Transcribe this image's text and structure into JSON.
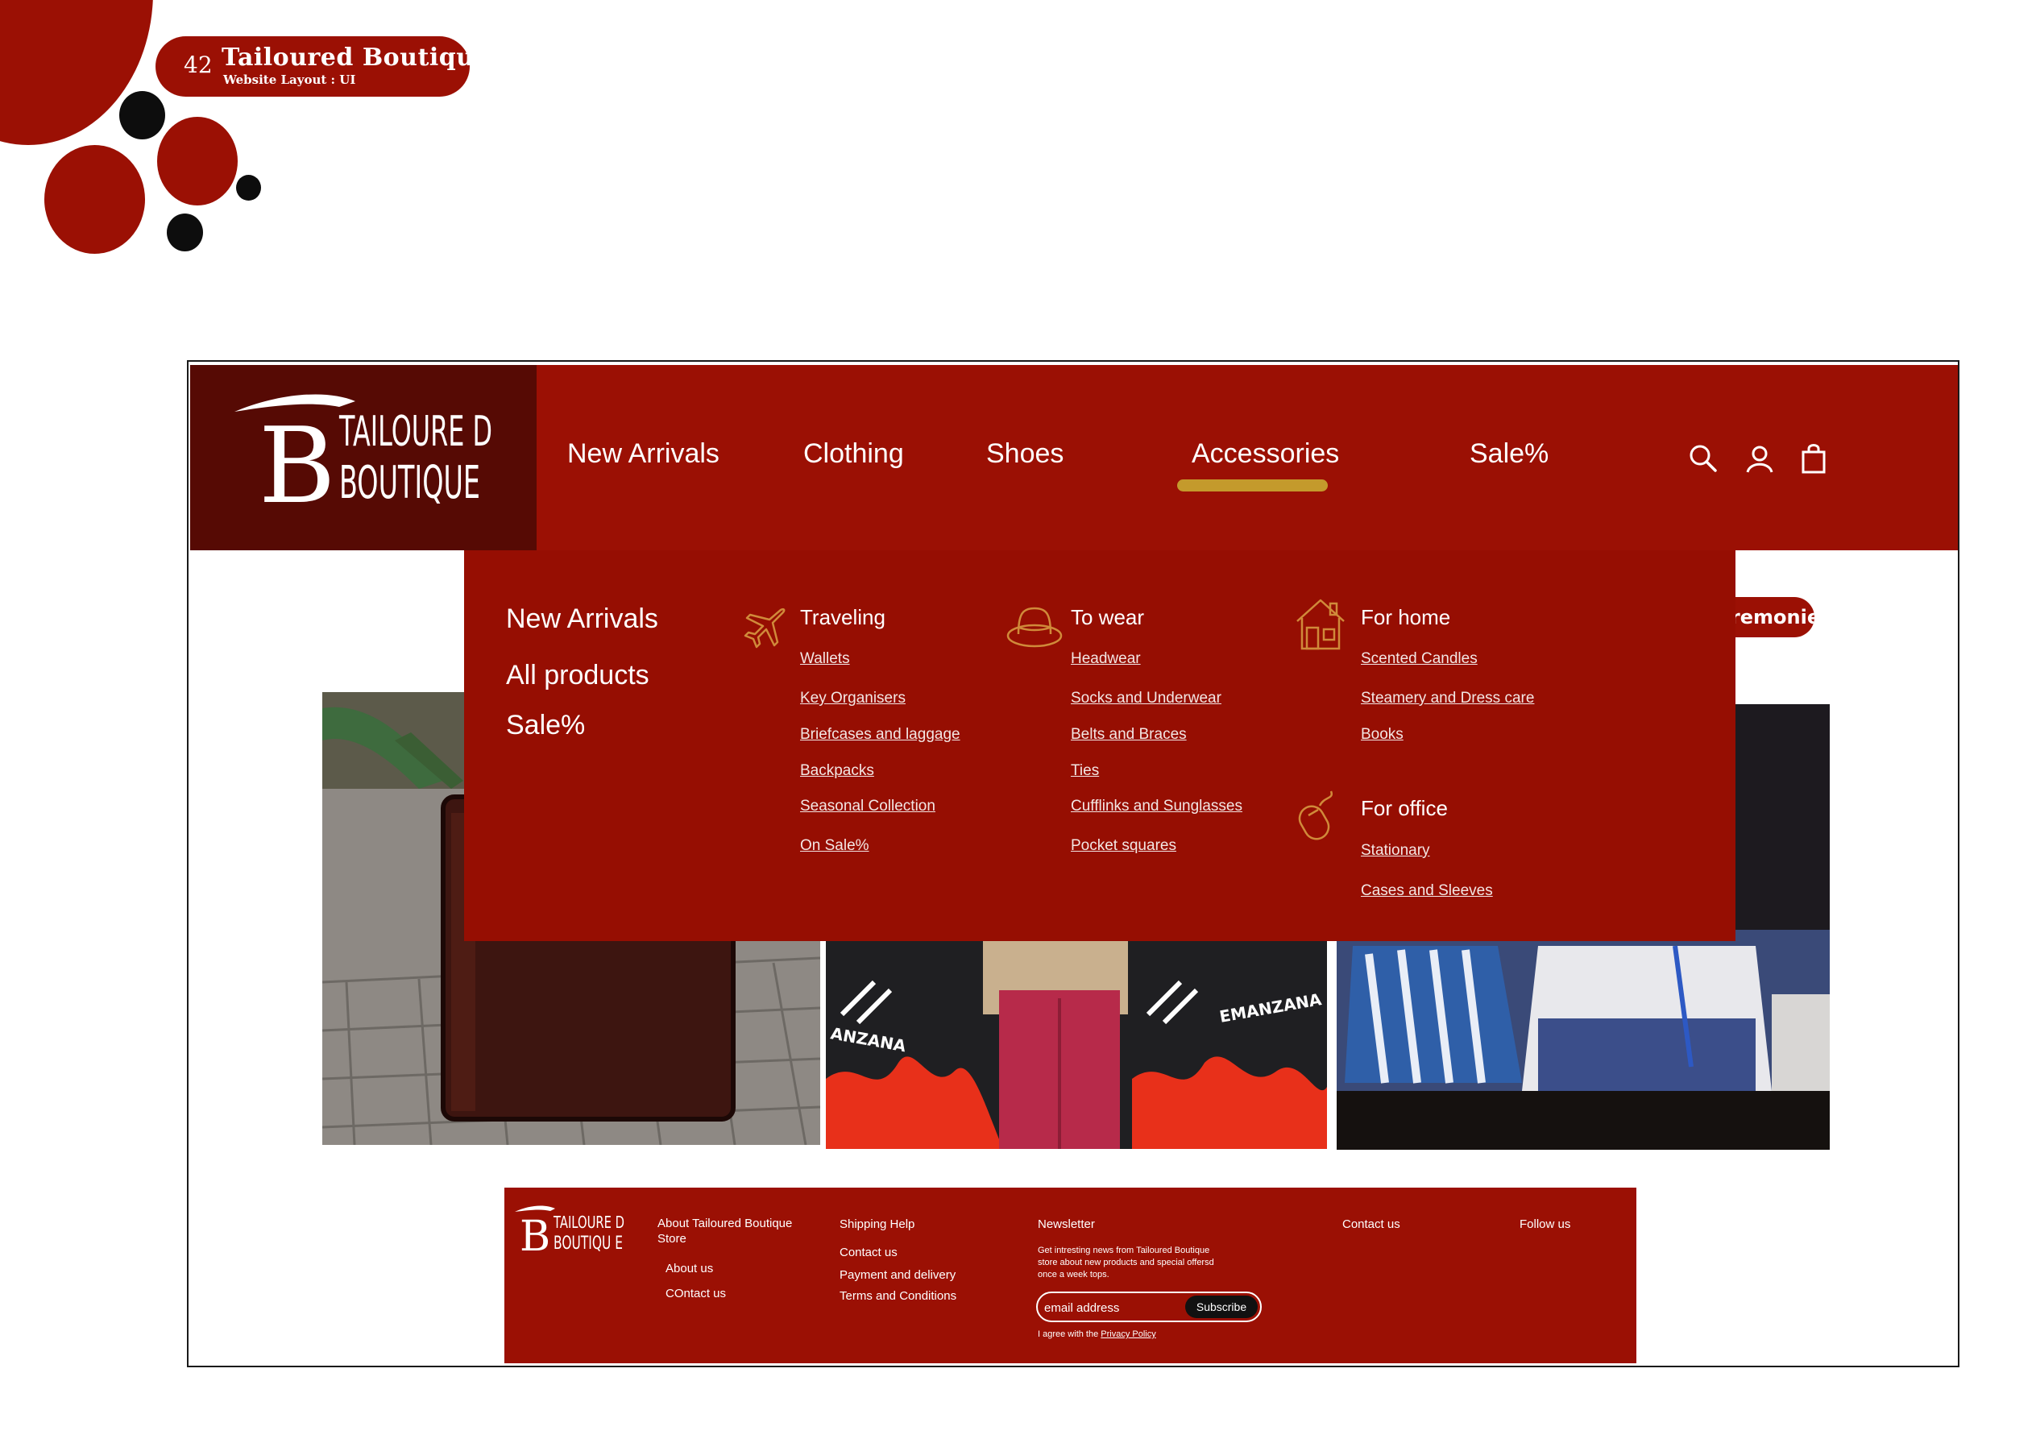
{
  "page_header": {
    "page_number": "42",
    "title": "Tailoured  Boutique",
    "subtitle": "Website Layout : UI"
  },
  "brand": {
    "logo_monogram": "B",
    "logo_line1": "TAILOURE D",
    "logo_line2": "BOUTIQUE"
  },
  "nav": {
    "items": [
      {
        "label": "New Arrivals"
      },
      {
        "label": "Clothing"
      },
      {
        "label": "Shoes"
      },
      {
        "label": "Accessories",
        "active": true
      },
      {
        "label": "Sale%"
      }
    ],
    "icons": [
      "search-icon",
      "account-icon",
      "shopping-bag-icon"
    ]
  },
  "banner": {
    "ceremonies_label": "Ceremonies"
  },
  "mega_menu": {
    "main_links": [
      "New Arrivals",
      "All products",
      "Sale%"
    ],
    "traveling": {
      "heading": "Traveling",
      "icon": "airplane-icon",
      "links": [
        "Wallets",
        "Key Organisers",
        "Briefcases and laggage",
        "Backpacks",
        "Seasonal Collection",
        "On Sale%"
      ]
    },
    "to_wear": {
      "heading": "To wear",
      "icon": "hat-icon",
      "links": [
        "Headwear",
        "Socks and Underwear",
        "Belts and Braces",
        "Ties",
        "Cufflinks and Sunglasses",
        "Pocket squares "
      ]
    },
    "for_home": {
      "heading": "For home",
      "icon": "house-icon",
      "links": [
        "Scented Candles",
        "Steamery and Dress care",
        "Books"
      ]
    },
    "for_office": {
      "heading": "For office",
      "icon": "computer-mouse-icon",
      "links": [
        "Stationary",
        "Cases  and Sleeves"
      ]
    }
  },
  "footer": {
    "logo_line1": "TAILOURE D",
    "logo_line2": "BOUTIQU E",
    "about_heading": "About Tailoured Boutique Store",
    "about_links": [
      "About us",
      "COntact us"
    ],
    "shipping_heading": "Shipping Help",
    "shipping_links": [
      "Contact us",
      "Payment and delivery",
      "Terms and Conditions"
    ],
    "newsletter_heading": "Newsletter",
    "newsletter_text": "Get intresting news  from Tailoured Boutique store about new products and special offersd once a week tops.",
    "email_placeholder": "email address",
    "subscribe_label": "Subscribe",
    "agree_prefix": "I agree with the ",
    "privacy_link": "Privacy Policy",
    "contact_heading": "Contact us",
    "follow_heading": "Follow us"
  },
  "colors": {
    "brand_red": "#9b1004",
    "dark_maroon": "#560a04",
    "accent_gold": "#c49a2c",
    "icon_gold": "#d08a3a"
  }
}
